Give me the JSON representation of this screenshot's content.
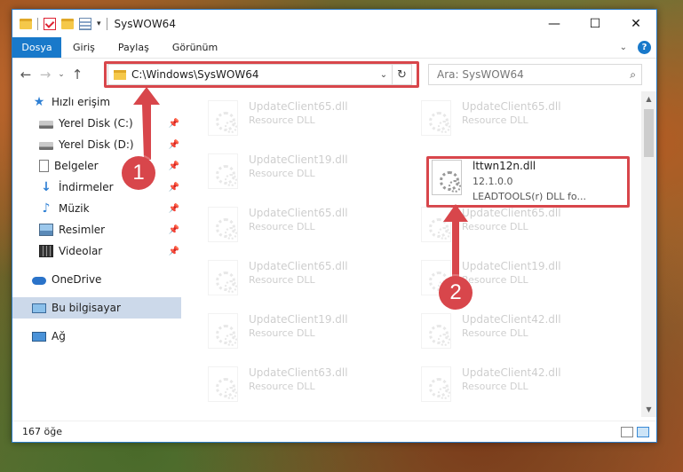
{
  "window": {
    "title": "SysWOW64"
  },
  "ribbon": {
    "tabs": [
      "Dosya",
      "Giriş",
      "Paylaş",
      "Görünüm"
    ],
    "help": "?"
  },
  "address": {
    "path": "C:\\Windows\\SysWOW64"
  },
  "search": {
    "placeholder": "Ara: SysWOW64"
  },
  "sidebar": {
    "quick_access": "Hızlı erişim",
    "items": [
      {
        "label": "Yerel Disk (C:)",
        "icon": "disk-icon"
      },
      {
        "label": "Yerel Disk (D:)",
        "icon": "disk-icon"
      },
      {
        "label": "Belgeler",
        "icon": "documents-icon"
      },
      {
        "label": "İndirmeler",
        "icon": "downloads-icon"
      },
      {
        "label": "Müzik",
        "icon": "music-icon"
      },
      {
        "label": "Resimler",
        "icon": "pictures-icon"
      },
      {
        "label": "Videolar",
        "icon": "videos-icon"
      }
    ],
    "onedrive": "OneDrive",
    "this_pc": "Bu bilgisayar",
    "network": "Ağ"
  },
  "files": [
    {
      "name": "UpdateClient65.dll",
      "desc": "Resource DLL"
    },
    {
      "name": "UpdateClient65.dll",
      "desc": "Resource DLL"
    },
    {
      "name": "UpdateClient19.dll",
      "desc": "Resource DLL"
    },
    {
      "name": "lttwn12n.dll",
      "version": "12.1.0.0",
      "desc": "LEADTOOLS(r) DLL fo..."
    },
    {
      "name": "UpdateClient65.dll",
      "desc": "Resource DLL"
    },
    {
      "name": "UpdateClient65.dll",
      "desc": "Resource DLL"
    },
    {
      "name": "UpdateClient65.dll",
      "desc": "Resource DLL"
    },
    {
      "name": "UpdateClient19.dll",
      "desc": "Resource DLL"
    },
    {
      "name": "UpdateClient19.dll",
      "desc": "Resource DLL"
    },
    {
      "name": "UpdateClient42.dll",
      "desc": "Resource DLL"
    },
    {
      "name": "UpdateClient63.dll",
      "desc": "Resource DLL"
    },
    {
      "name": "UpdateClient42.dll",
      "desc": "Resource DLL"
    }
  ],
  "status": {
    "count": "167 öğe"
  },
  "callouts": [
    "1",
    "2"
  ],
  "colors": {
    "accent": "#1979ca",
    "highlight": "#d8464b"
  }
}
